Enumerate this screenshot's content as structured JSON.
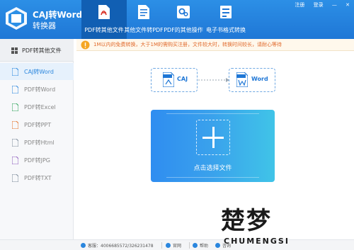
{
  "brand": {
    "title": "CAJ转Word",
    "subtitle": "转换器"
  },
  "tabs": [
    {
      "label": "PDF转其他文件",
      "icon": "pdf-file-icon"
    },
    {
      "label": "其他文件转PDF",
      "icon": "document-icon"
    },
    {
      "label": "PDF的其他操作",
      "icon": "gears-icon"
    },
    {
      "label": "电子书格式转换",
      "icon": "ebook-icon"
    }
  ],
  "top_links": {
    "register": "注册",
    "login": "登录",
    "minimize": "—",
    "close": "✕"
  },
  "notice": {
    "text": "1M以内的免费转换，大于1M的需购买注册，文件较大时，转换时间较长，请耐心等待"
  },
  "sidebar": {
    "header": "PDF转其他文件",
    "items": [
      {
        "label": "CAJ转Word",
        "color": "#2a86de"
      },
      {
        "label": "PDF转Word",
        "color": "#2a86de"
      },
      {
        "label": "PDF转Excel",
        "color": "#2ea55a"
      },
      {
        "label": "PDF转PPT",
        "color": "#e4762d"
      },
      {
        "label": "PDF转Html",
        "color": "#7d8b9a"
      },
      {
        "label": "PDF转JPG",
        "color": "#8f5fbf"
      },
      {
        "label": "PDF转TXT",
        "color": "#7d8b9a"
      }
    ]
  },
  "flow": {
    "from": "CAJ",
    "to": "Word",
    "from_badge": "CAJ",
    "to_badge": "WORD",
    "to_letter": "W"
  },
  "dropzone": {
    "label": "点击选择文件"
  },
  "footer": {
    "qq": "客服：4006685572/326231478",
    "website": "官网",
    "help": "帮助",
    "consult": "咨询"
  },
  "watermark": {
    "big": "楚梦",
    "small": "CHUMENGSI"
  },
  "colors": {
    "brand_blue": "#1f77d6",
    "active_tab": "#115fb3",
    "notice_orange": "#e06a2c"
  }
}
